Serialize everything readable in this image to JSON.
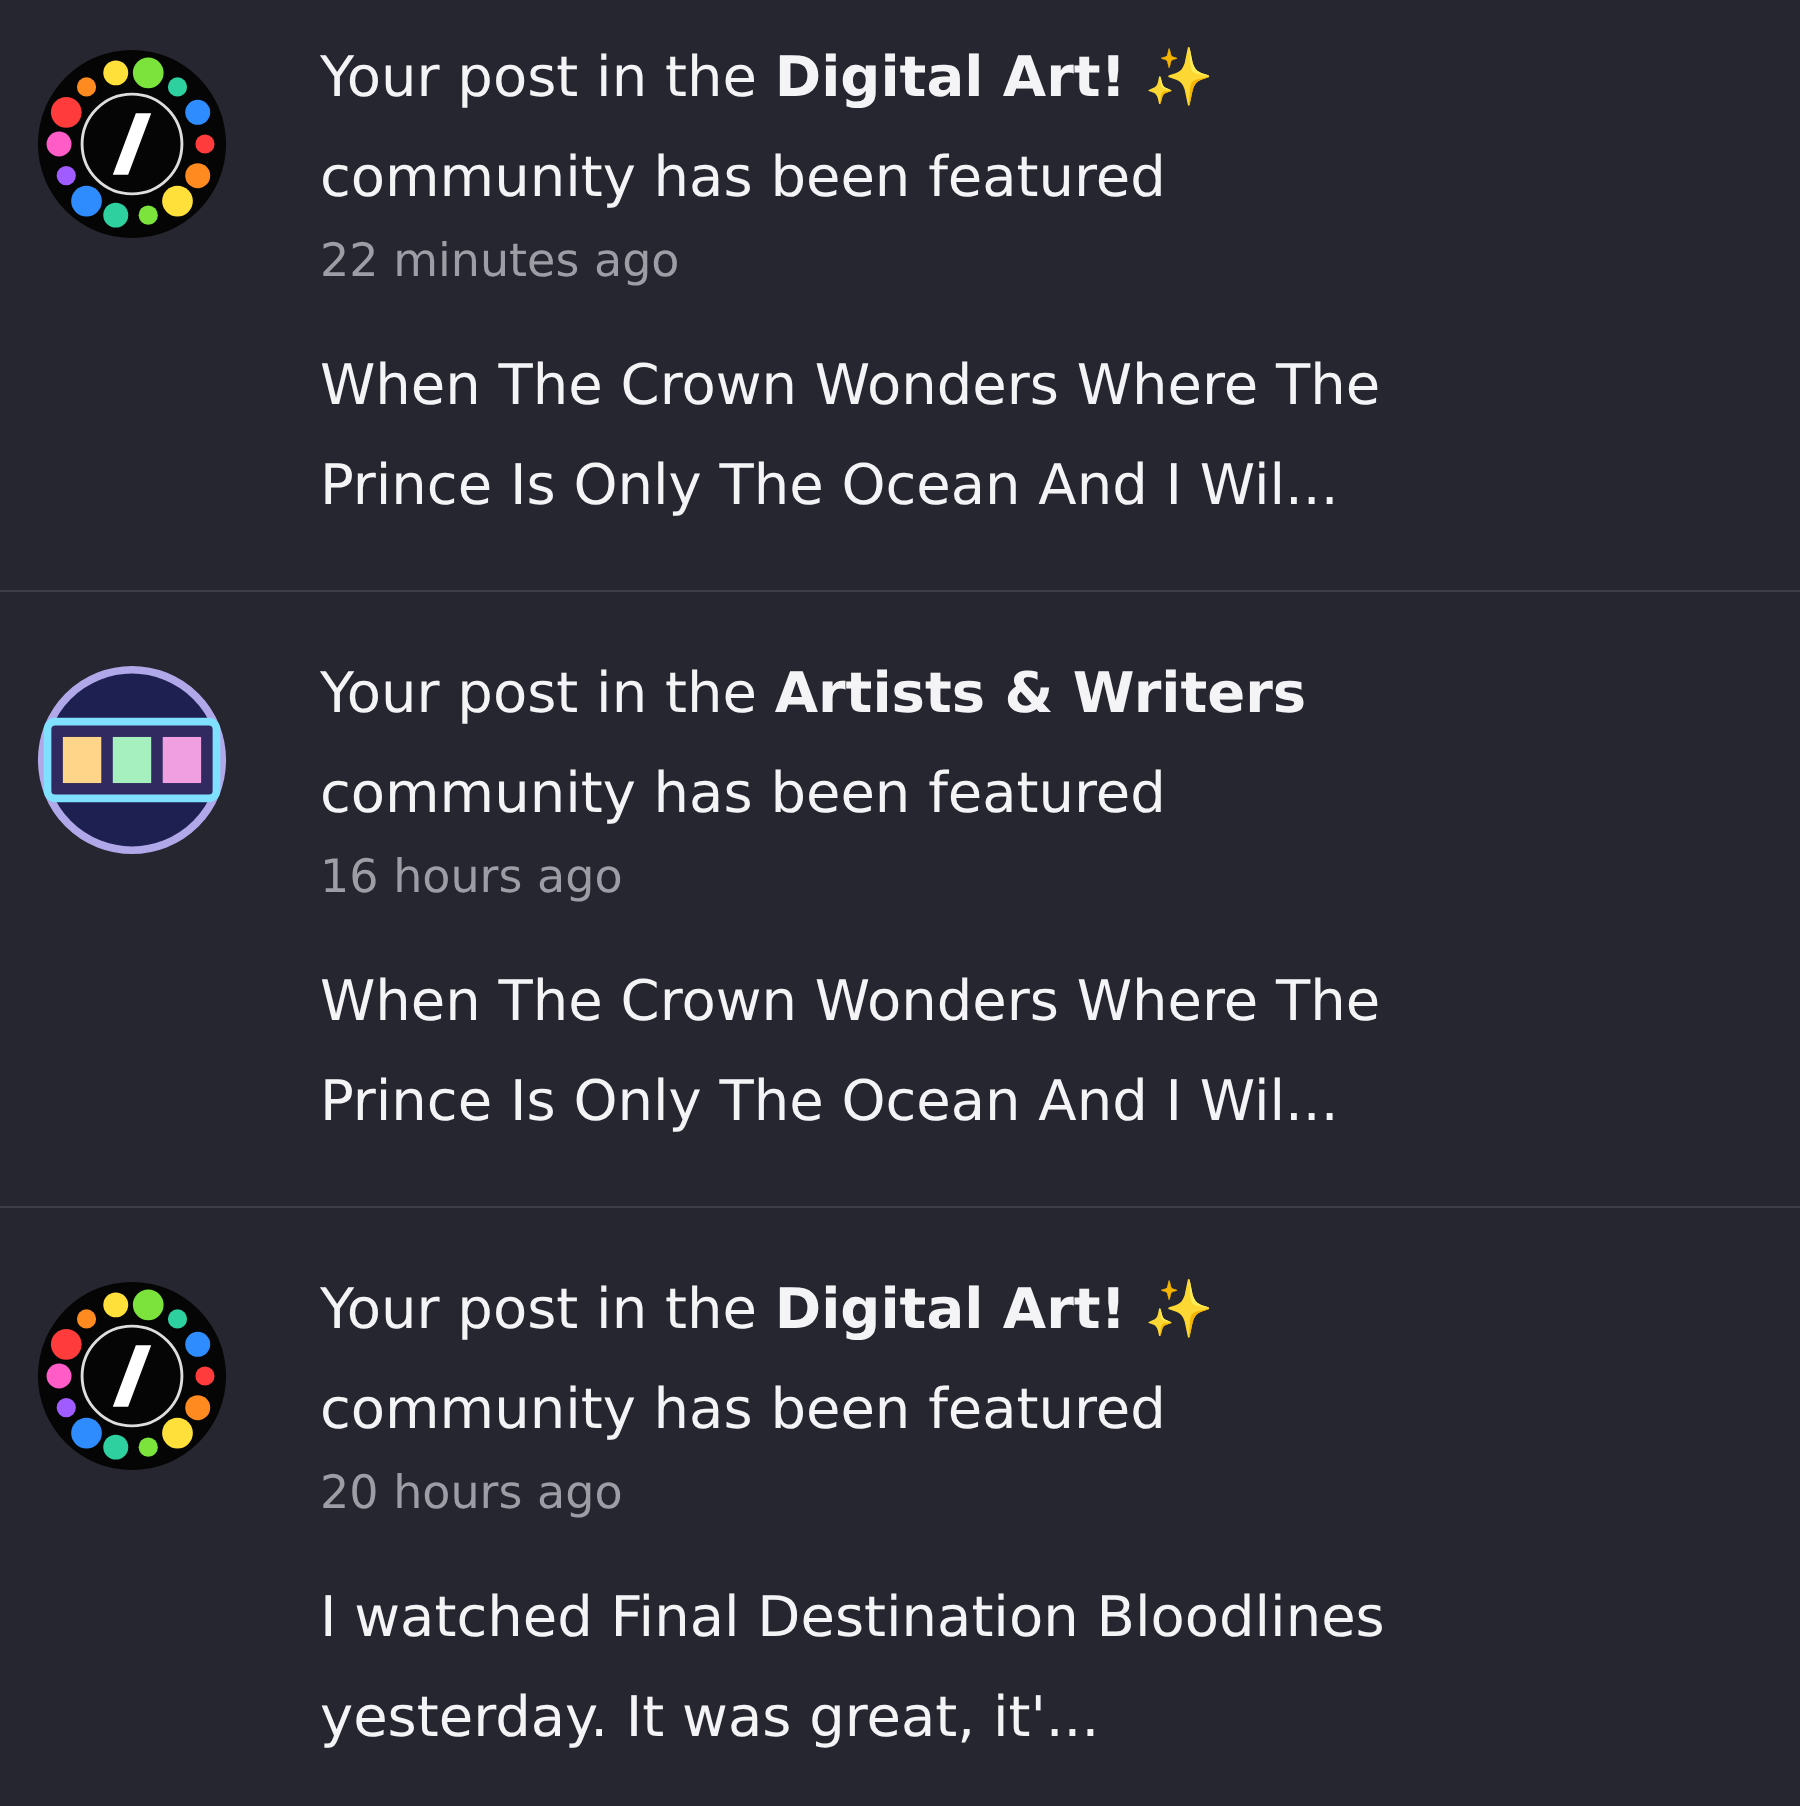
{
  "notifications": [
    {
      "avatar": {
        "kind": "dots"
      },
      "title_lines": [
        "Your post in the **Digital Art!** ✨",
        "community has been featured"
      ],
      "time": "22 minutes ago",
      "preview_lines": [
        "When The Crown Wonders Where The",
        "Prince Is Only The Ocean And I Wil..."
      ]
    },
    {
      "avatar": {
        "kind": "badge"
      },
      "title_lines": [
        "Your post in the **Artists & Writers**",
        "community has been featured"
      ],
      "time": "16 hours ago",
      "preview_lines": [
        "When The Crown Wonders Where The",
        "Prince Is Only The Ocean And I Wil..."
      ]
    },
    {
      "avatar": {
        "kind": "dots"
      },
      "title_lines": [
        "Your post in the **Digital Art!** ✨",
        "community has been featured"
      ],
      "time": "20 hours ago",
      "preview_lines": [
        "I watched Final Destination Bloodlines",
        "yesterday. It was great, it'..."
      ]
    }
  ]
}
